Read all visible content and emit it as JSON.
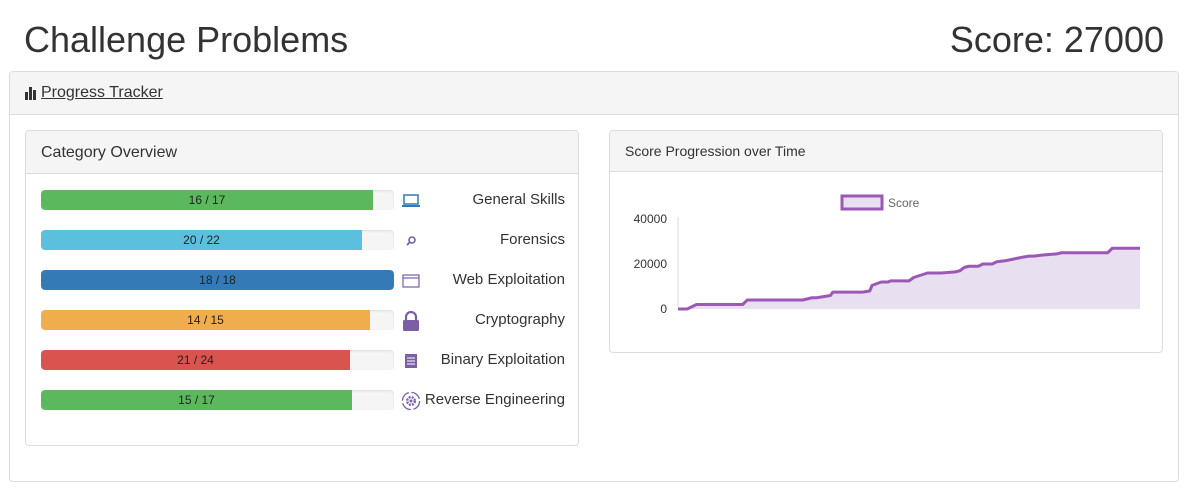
{
  "header": {
    "title": "Challenge Problems",
    "score_text": "Score: 27000"
  },
  "tracker": {
    "label": "Progress Tracker",
    "icon": "bar-chart-icon"
  },
  "categories_panel": {
    "title": "Category Overview",
    "items": [
      {
        "name": "General Skills",
        "solved": 16,
        "total": 17,
        "text": "16 / 17",
        "color": "#5cb85c",
        "icon": "laptop-icon"
      },
      {
        "name": "Forensics",
        "solved": 20,
        "total": 22,
        "text": "20 / 22",
        "color": "#5bc0de",
        "icon": "search-icon"
      },
      {
        "name": "Web Exploitation",
        "solved": 18,
        "total": 18,
        "text": "18 / 18",
        "color": "#337ab7",
        "icon": "browser-window-icon"
      },
      {
        "name": "Cryptography",
        "solved": 14,
        "total": 15,
        "text": "14 / 15",
        "color": "#f0ad4e",
        "icon": "lock-icon"
      },
      {
        "name": "Binary Exploitation",
        "solved": 21,
        "total": 24,
        "text": "21 / 24",
        "color": "#d9534f",
        "icon": "binary-file-icon"
      },
      {
        "name": "Reverse Engineering",
        "solved": 15,
        "total": 17,
        "text": "15 / 17",
        "color": "#5cb85c",
        "icon": "gear-cycle-icon"
      }
    ]
  },
  "chart_panel": {
    "title": "Score Progression over Time"
  },
  "chart_data": {
    "type": "area",
    "title": "",
    "xlabel": "",
    "ylabel": "",
    "ylim": [
      0,
      40000
    ],
    "y_ticks": [
      "40000",
      "20000",
      "0"
    ],
    "legend": {
      "label": "Score",
      "position": "top-center"
    },
    "grid": false,
    "x_tick_labels": false,
    "color": "#9b59b6",
    "fill_color": "#e8dff0",
    "series": [
      {
        "name": "Score",
        "x": [
          0,
          2,
          3,
          4,
          14,
          15,
          27,
          29,
          30,
          33,
          33.5,
          40,
          41.5,
          42,
          44,
          45.5,
          46,
          50,
          51,
          54,
          57,
          60,
          61,
          62,
          63,
          64,
          65,
          66,
          68,
          69,
          71,
          74.5,
          76,
          77,
          79,
          82,
          83,
          93,
          94,
          100
        ],
        "y": [
          0,
          0,
          1000,
          2000,
          2000,
          4000,
          4000,
          5000,
          5000,
          6000,
          7500,
          7500,
          8000,
          10500,
          12000,
          12000,
          12500,
          12500,
          14000,
          16000,
          16000,
          16500,
          17000,
          18500,
          19000,
          19000,
          19000,
          20000,
          20000,
          21000,
          21500,
          23000,
          23500,
          23500,
          24000,
          24500,
          25000,
          25000,
          27000,
          27000
        ]
      }
    ]
  }
}
